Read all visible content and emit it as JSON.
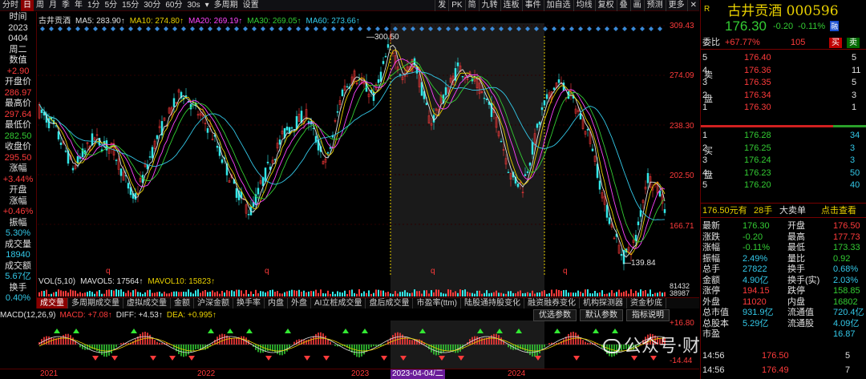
{
  "toolbar": {
    "items": [
      "分时",
      "日",
      "周",
      "月",
      "季",
      "年",
      "1分",
      "5分",
      "15分",
      "30分",
      "60分",
      "30s",
      "多周期",
      "设置"
    ],
    "selected": 1,
    "dropdown_after": 11,
    "right_items": [
      "发",
      "PK",
      "简",
      "九转",
      "连板",
      "事件",
      "加自选",
      "均线",
      "复权",
      "叠",
      "画",
      "预测",
      "更多"
    ]
  },
  "left_info": {
    "rows": [
      {
        "t": "时间",
        "c": "w"
      },
      {
        "t": "2023",
        "c": "w"
      },
      {
        "t": "0404",
        "c": "w"
      },
      {
        "t": "周二",
        "c": "w"
      },
      {
        "t": "数值",
        "c": "w"
      },
      {
        "t": "+2.90",
        "c": "r"
      },
      {
        "t": "开盘价",
        "c": "w"
      },
      {
        "t": "286.97",
        "c": "r"
      },
      {
        "t": "最高价",
        "c": "w"
      },
      {
        "t": "297.64",
        "c": "r"
      },
      {
        "t": "最低价",
        "c": "w"
      },
      {
        "t": "282.50",
        "c": "g"
      },
      {
        "t": "收盘价",
        "c": "w"
      },
      {
        "t": "295.50",
        "c": "r"
      },
      {
        "t": "涨幅",
        "c": "w"
      },
      {
        "t": "+3.44%",
        "c": "r"
      },
      {
        "t": "开盘",
        "c": "w"
      },
      {
        "t": "涨幅",
        "c": "w"
      },
      {
        "t": "+0.46%",
        "c": "r"
      },
      {
        "t": "振幅",
        "c": "w"
      },
      {
        "t": "5.30%",
        "c": "c"
      },
      {
        "t": "成交量",
        "c": "w"
      },
      {
        "t": "18940",
        "c": "c"
      },
      {
        "t": "成交额",
        "c": "w"
      },
      {
        "t": "5.67亿",
        "c": "c"
      },
      {
        "t": "换手",
        "c": "w"
      },
      {
        "t": "0.40%",
        "c": "c"
      }
    ]
  },
  "ma_legend": [
    {
      "t": "古井贡酒",
      "c": "#e0e0e0"
    },
    {
      "t": "MA5: 283.90↑",
      "c": "#e0e0e0"
    },
    {
      "t": "MA10: 274.80↑",
      "c": "#e8d000"
    },
    {
      "t": "MA20: 269.19↑",
      "c": "#ff44ff"
    },
    {
      "t": "MA30: 269.05↑",
      "c": "#33cc33"
    },
    {
      "t": "MA60: 273.66↑",
      "c": "#33c8e8"
    }
  ],
  "price_axis": [
    "309.43",
    "274.09",
    "238.30",
    "202.50",
    "166.71"
  ],
  "annotations": {
    "high": "300.50",
    "low": "139.84",
    "marker": "q",
    "cross_date": "2023-04-04/二"
  },
  "vol_legend": [
    {
      "t": "VOL(5,10)",
      "c": "#e0e0e0"
    },
    {
      "t": "MAVOL5: 17564↑",
      "c": "#e0e0e0"
    },
    {
      "t": "MAVOL10: 15823↑",
      "c": "#e8d000"
    }
  ],
  "vol_axis": [
    "81432",
    "38987"
  ],
  "indicator_tabs": [
    "成交量",
    "多周期成交量",
    "虚拟成交量",
    "金额",
    "沪深金额",
    "换手率",
    "内盘",
    "外盘",
    "AI立桩成交量",
    "盘后成交量",
    "市盈率(ttm)",
    "陆股通持股变化",
    "融资融券变化",
    "机构探测器",
    "资金秒底"
  ],
  "indicator_selected": 0,
  "macd_legend": [
    {
      "t": "MACD(12,26,9)",
      "c": "#e0e0e0"
    },
    {
      "t": "MACD: +7.08↑",
      "c": "#ff3b3b"
    },
    {
      "t": "DIFF: +4.53↑",
      "c": "#e0e0e0"
    },
    {
      "t": "DEA: +0.995↑",
      "c": "#e8d000"
    }
  ],
  "macd_buttons": [
    "优选参数",
    "默认参数",
    "指标说明"
  ],
  "macd_axis": [
    "+16.80",
    "-14.44"
  ],
  "date_axis": [
    "2021",
    "2022",
    "2023",
    "2023-04-04/二",
    "2024"
  ],
  "watermark": "公众号·财富流用者",
  "quote": {
    "tag": "R",
    "name": "古井贡酒 000596",
    "price": "176.30",
    "change": "-0.20",
    "change_pct": "-0.11%",
    "badge": "融",
    "weibi_label": "委比",
    "weibi": "+67.77%",
    "weibi_diff": "105",
    "buy_btn": "买",
    "sell_btn": "卖",
    "sell_side_label": [
      "卖",
      "盘"
    ],
    "buy_side_label": [
      "买",
      "盘"
    ],
    "asks": [
      {
        "lv": "5",
        "price": "176.40",
        "vol": "5"
      },
      {
        "lv": "4",
        "price": "176.36",
        "vol": "11"
      },
      {
        "lv": "3",
        "price": "176.35",
        "vol": "5"
      },
      {
        "lv": "2",
        "price": "176.34",
        "vol": "3"
      },
      {
        "lv": "1",
        "price": "176.30",
        "vol": "1"
      }
    ],
    "bids": [
      {
        "lv": "1",
        "price": "176.28",
        "vol": "34"
      },
      {
        "lv": "2",
        "price": "176.25",
        "vol": "3"
      },
      {
        "lv": "3",
        "price": "176.24",
        "vol": "3"
      },
      {
        "lv": "4",
        "price": "176.23",
        "vol": "50"
      },
      {
        "lv": "5",
        "price": "176.20",
        "vol": "40"
      }
    ],
    "big_order": {
      "price": "176.50元有",
      "qty": "28手",
      "label": "大卖单",
      "link": "点击查看"
    },
    "stats": [
      [
        "最新",
        "176.30",
        "g",
        "开盘",
        "176.50",
        "r"
      ],
      [
        "涨跌",
        "-0.20",
        "g",
        "最高",
        "177.73",
        "r"
      ],
      [
        "涨幅",
        "-0.11%",
        "g",
        "最低",
        "173.33",
        "g"
      ],
      [
        "振幅",
        "2.49%",
        "c",
        "量比",
        "0.92",
        "g"
      ],
      [
        "总手",
        "27822",
        "c",
        "换手",
        "0.68%",
        "c"
      ],
      [
        "金额",
        "4.90亿",
        "c",
        "换手(实)",
        "2.03%",
        "c"
      ],
      [
        "涨停",
        "194.15",
        "r",
        "跌停",
        "158.85",
        "g"
      ],
      [
        "外盘",
        "11020",
        "r",
        "内盘",
        "16802",
        "g"
      ],
      [
        "总市值",
        "931.9亿",
        "c",
        "流通值",
        "720.4亿",
        "c"
      ],
      [
        "总股本",
        "5.29亿",
        "c",
        "流通股",
        "4.09亿",
        "c"
      ],
      [
        "市盈",
        "",
        "w",
        "",
        "16.87",
        "c"
      ]
    ],
    "ticks": [
      {
        "time": "14:56",
        "price": "176.50",
        "vol": "5"
      },
      {
        "time": "14:56",
        "price": "176.49",
        "vol": "7"
      }
    ]
  }
}
